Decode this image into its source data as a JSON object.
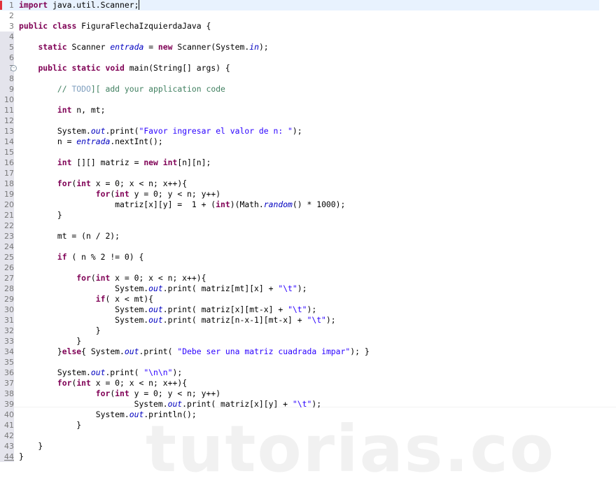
{
  "watermark": "tutorias.co",
  "current_line": 1,
  "colors": {
    "keyword": "#7f0055",
    "string": "#2a00ff",
    "field": "#0000c0",
    "comment": "#3f7f5f",
    "todo": "#7f9fbf",
    "current_line_bg": "#e8f2fe"
  },
  "lines": [
    [
      [
        "k",
        "import"
      ],
      [
        "p",
        " java.util.Scanner;"
      ]
    ],
    [],
    [
      [
        "k",
        "public"
      ],
      [
        "p",
        " "
      ],
      [
        "k",
        "class"
      ],
      [
        "p",
        " FiguraFlechaIzquierdaJava {"
      ]
    ],
    [],
    [
      [
        "p",
        "    "
      ],
      [
        "k",
        "static"
      ],
      [
        "p",
        " Scanner "
      ],
      [
        "f",
        "entrada"
      ],
      [
        "p",
        " = "
      ],
      [
        "k",
        "new"
      ],
      [
        "p",
        " Scanner(System."
      ],
      [
        "f",
        "in"
      ],
      [
        "p",
        ");"
      ]
    ],
    [],
    [
      [
        "p",
        "    "
      ],
      [
        "k",
        "public"
      ],
      [
        "p",
        " "
      ],
      [
        "k",
        "static"
      ],
      [
        "p",
        " "
      ],
      [
        "k",
        "void"
      ],
      [
        "p",
        " main(String[] args) {"
      ]
    ],
    [],
    [
      [
        "p",
        "        "
      ],
      [
        "c",
        "// "
      ],
      [
        "t",
        "TODO"
      ],
      [
        "c",
        "][ add your application code"
      ]
    ],
    [],
    [
      [
        "p",
        "        "
      ],
      [
        "k",
        "int"
      ],
      [
        "p",
        " n, mt;"
      ]
    ],
    [],
    [
      [
        "p",
        "        System."
      ],
      [
        "f",
        "out"
      ],
      [
        "p",
        ".print("
      ],
      [
        "s",
        "\"Favor ingresar el valor de n: \""
      ],
      [
        "p",
        ");"
      ]
    ],
    [
      [
        "p",
        "        n = "
      ],
      [
        "f",
        "entrada"
      ],
      [
        "p",
        ".nextInt();"
      ]
    ],
    [],
    [
      [
        "p",
        "        "
      ],
      [
        "k",
        "int"
      ],
      [
        "p",
        " [][] matriz = "
      ],
      [
        "k",
        "new"
      ],
      [
        "p",
        " "
      ],
      [
        "k",
        "int"
      ],
      [
        "p",
        "[n][n];"
      ]
    ],
    [],
    [
      [
        "p",
        "        "
      ],
      [
        "k",
        "for"
      ],
      [
        "p",
        "("
      ],
      [
        "k",
        "int"
      ],
      [
        "p",
        " x = 0; x < n; x++){"
      ]
    ],
    [
      [
        "p",
        "                "
      ],
      [
        "k",
        "for"
      ],
      [
        "p",
        "("
      ],
      [
        "k",
        "int"
      ],
      [
        "p",
        " y = 0; y < n; y++)"
      ]
    ],
    [
      [
        "p",
        "                    matriz[x][y] =  1 + ("
      ],
      [
        "k",
        "int"
      ],
      [
        "p",
        ")(Math."
      ],
      [
        "f",
        "random"
      ],
      [
        "p",
        "() * 1000);"
      ]
    ],
    [
      [
        "p",
        "        }"
      ]
    ],
    [],
    [
      [
        "p",
        "        mt = (n / 2);"
      ]
    ],
    [],
    [
      [
        "p",
        "        "
      ],
      [
        "k",
        "if"
      ],
      [
        "p",
        " ( n % 2 != 0) {"
      ]
    ],
    [],
    [
      [
        "p",
        "            "
      ],
      [
        "k",
        "for"
      ],
      [
        "p",
        "("
      ],
      [
        "k",
        "int"
      ],
      [
        "p",
        " x = 0; x < n; x++){"
      ]
    ],
    [
      [
        "p",
        "                    System."
      ],
      [
        "f",
        "out"
      ],
      [
        "p",
        ".print( matriz[mt][x] + "
      ],
      [
        "s",
        "\"\\t\""
      ],
      [
        "p",
        ");"
      ]
    ],
    [
      [
        "p",
        "                "
      ],
      [
        "k",
        "if"
      ],
      [
        "p",
        "( x < mt){"
      ]
    ],
    [
      [
        "p",
        "                    System."
      ],
      [
        "f",
        "out"
      ],
      [
        "p",
        ".print( matriz[x][mt-x] + "
      ],
      [
        "s",
        "\"\\t\""
      ],
      [
        "p",
        ");"
      ]
    ],
    [
      [
        "p",
        "                    System."
      ],
      [
        "f",
        "out"
      ],
      [
        "p",
        ".print( matriz[n-x-1][mt-x] + "
      ],
      [
        "s",
        "\"\\t\""
      ],
      [
        "p",
        ");"
      ]
    ],
    [
      [
        "p",
        "                }"
      ]
    ],
    [
      [
        "p",
        "            }"
      ]
    ],
    [
      [
        "p",
        "        }"
      ],
      [
        "k",
        "else"
      ],
      [
        "p",
        "{ System."
      ],
      [
        "f",
        "out"
      ],
      [
        "p",
        ".print( "
      ],
      [
        "s",
        "\"Debe ser una matriz cuadrada impar\""
      ],
      [
        "p",
        "); }"
      ]
    ],
    [],
    [
      [
        "p",
        "        System."
      ],
      [
        "f",
        "out"
      ],
      [
        "p",
        ".print( "
      ],
      [
        "s",
        "\"\\n\\n\""
      ],
      [
        "p",
        ");"
      ]
    ],
    [
      [
        "p",
        "        "
      ],
      [
        "k",
        "for"
      ],
      [
        "p",
        "("
      ],
      [
        "k",
        "int"
      ],
      [
        "p",
        " x = 0; x < n; x++){"
      ]
    ],
    [
      [
        "p",
        "                "
      ],
      [
        "k",
        "for"
      ],
      [
        "p",
        "("
      ],
      [
        "k",
        "int"
      ],
      [
        "p",
        " y = 0; y < n; y++)"
      ]
    ],
    [
      [
        "p",
        "                        System."
      ],
      [
        "f",
        "out"
      ],
      [
        "p",
        ".print( matriz[x][y] + "
      ],
      [
        "s",
        "\"\\t\""
      ],
      [
        "p",
        ");"
      ]
    ],
    [
      [
        "p",
        "                System."
      ],
      [
        "f",
        "out"
      ],
      [
        "p",
        ".println();"
      ]
    ],
    [
      [
        "p",
        "            }"
      ]
    ],
    [],
    [
      [
        "p",
        "    }"
      ]
    ],
    [
      [
        "p",
        "}"
      ]
    ]
  ]
}
